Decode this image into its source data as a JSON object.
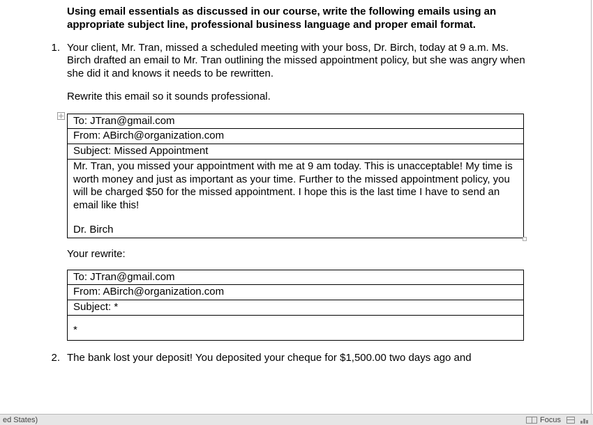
{
  "instructions": "Using email essentials as discussed in our course, write the following emails using an appropriate subject line, professional business language and proper email format.",
  "q1": {
    "number": "1.",
    "paragraph": "Your client, Mr. Tran, missed a scheduled meeting with your boss, Dr. Birch, today at 9 a.m.  Ms. Birch drafted an email to Mr. Tran outlining the missed appointment policy, but she was angry when she did it and knows it needs to be rewritten.",
    "task": "Rewrite this email so it sounds professional.",
    "email": {
      "to": "To:  JTran@gmail.com",
      "from": "From:  ABirch@organization.com",
      "subject": "Subject:  Missed Appointment",
      "body": "Mr. Tran, you missed your appointment with me at 9 am today.  This is unacceptable!  My time is worth money and just as important as your time.  Further to the missed appointment policy, you will be charged $50 for the missed appointment. I hope this is the last time I have to send an email like this!",
      "signature": "Dr. Birch"
    },
    "rewrite_label": "Your rewrite:",
    "rewrite": {
      "to": "To:  JTran@gmail.com",
      "from": "From:  ABirch@organization.com",
      "subject": "Subject:  *",
      "body": "*"
    }
  },
  "q2": {
    "number": "2.",
    "paragraph_cut": "The bank lost your deposit! You deposited your cheque for $1,500.00 two days ago and"
  },
  "statusbar": {
    "lang_fragment": "ed States)",
    "focus": "Focus"
  }
}
